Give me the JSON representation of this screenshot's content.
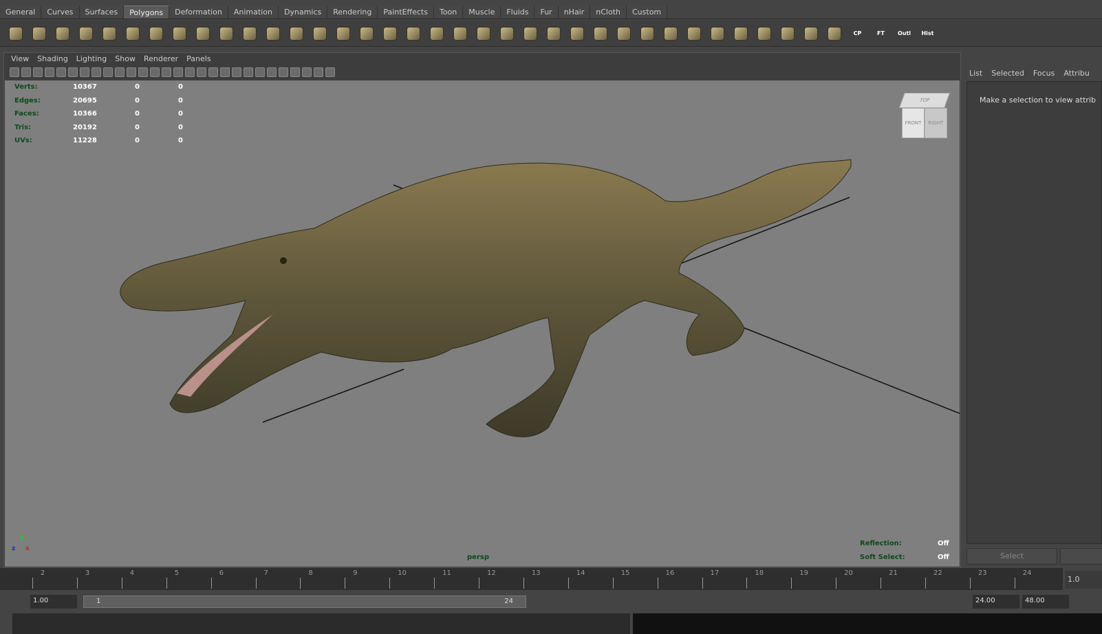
{
  "shelf_tabs": [
    "General",
    "Curves",
    "Surfaces",
    "Polygons",
    "Deformation",
    "Animation",
    "Dynamics",
    "Rendering",
    "PaintEffects",
    "Toon",
    "Muscle",
    "Fluids",
    "Fur",
    "nHair",
    "nCloth",
    "Custom"
  ],
  "active_tab": "Polygons",
  "shelf_icon_labels": {
    "cp": "CP",
    "ft": "FT",
    "outl": "Outl",
    "hist": "Hist"
  },
  "viewport_menu": [
    "View",
    "Shading",
    "Lighting",
    "Show",
    "Renderer",
    "Panels"
  ],
  "stats": [
    {
      "label": "Verts:",
      "v": "10367",
      "s1": "0",
      "s2": "0"
    },
    {
      "label": "Edges:",
      "v": "20695",
      "s1": "0",
      "s2": "0"
    },
    {
      "label": "Faces:",
      "v": "10366",
      "s1": "0",
      "s2": "0"
    },
    {
      "label": "Tris:",
      "v": "20192",
      "s1": "0",
      "s2": "0"
    },
    {
      "label": "UVs:",
      "v": "11228",
      "s1": "0",
      "s2": "0"
    }
  ],
  "camera": "persp",
  "viewcube": {
    "top": "TOP",
    "front": "FRONT",
    "right": "RIGHT"
  },
  "hud_right": [
    {
      "label": "Reflection:",
      "value": "Off"
    },
    {
      "label": "Soft Select:",
      "value": "Off"
    }
  ],
  "attr_panel": {
    "tabs": [
      "List",
      "Selected",
      "Focus",
      "Attribu"
    ],
    "message": "Make a selection to view attrib",
    "select_button": "Select"
  },
  "timeline": {
    "ticks": [
      "2",
      "3",
      "4",
      "5",
      "6",
      "7",
      "8",
      "9",
      "10",
      "11",
      "12",
      "13",
      "14",
      "15",
      "16",
      "17",
      "18",
      "19",
      "20",
      "21",
      "22",
      "23",
      "24"
    ],
    "current": "1.0"
  },
  "range": {
    "start": "1.00",
    "slider_start": "1",
    "slider_end": "24",
    "end": "24.00",
    "anim_end": "48.00"
  },
  "colors": {
    "hud_label": "#0d4a1d",
    "viewport_bg": "#7f7f7f"
  }
}
